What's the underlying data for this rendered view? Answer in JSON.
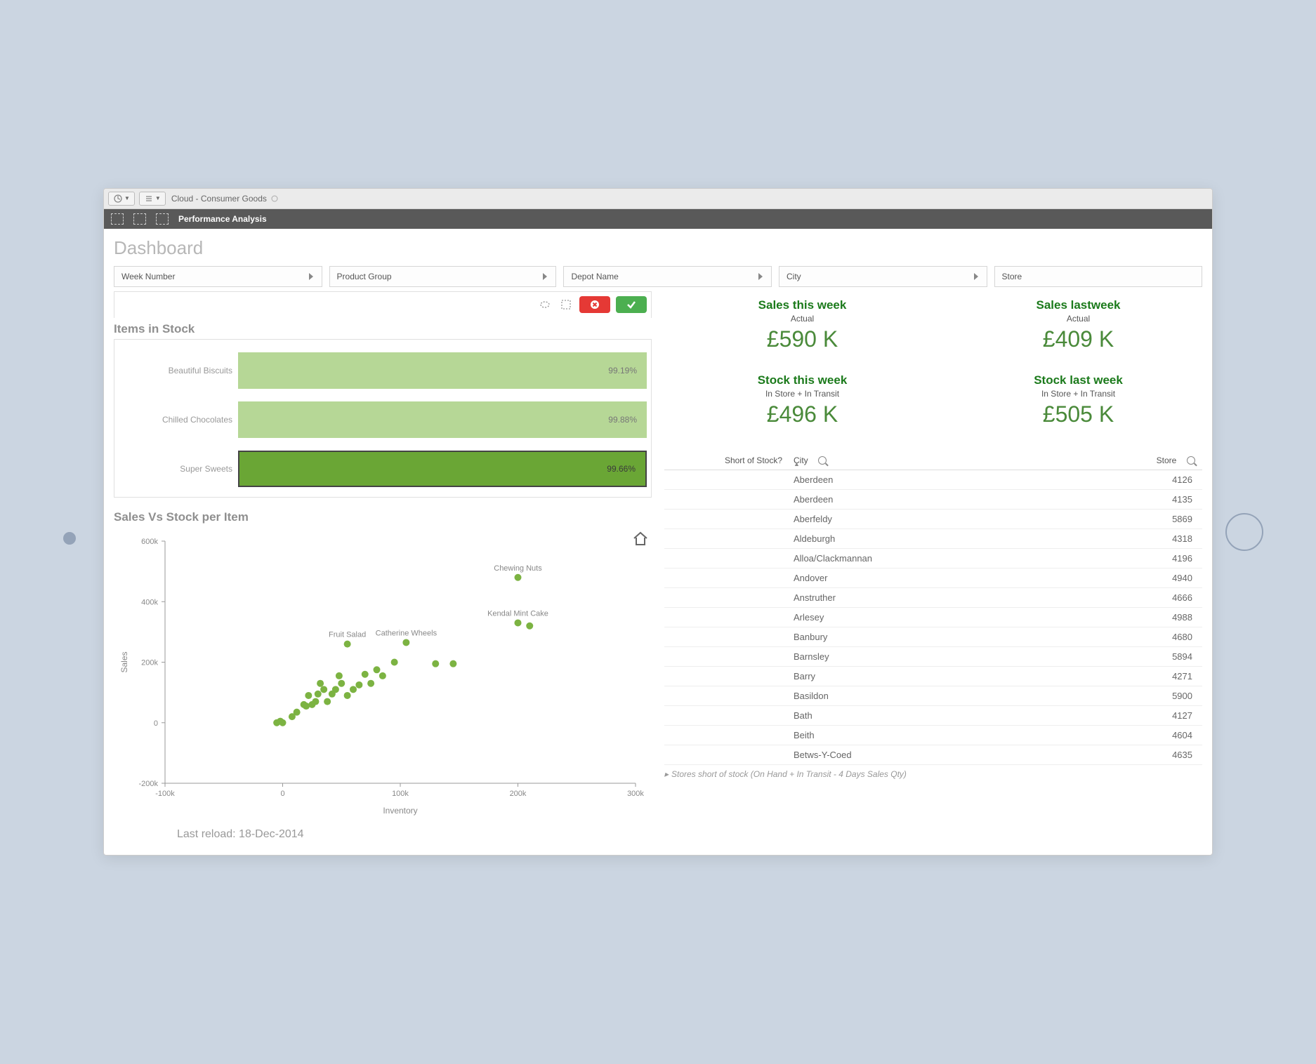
{
  "titlebar": {
    "app_name": "Cloud - Consumer Goods"
  },
  "darkbar": {
    "title": "Performance Analysis"
  },
  "dashboard_heading": "Dashboard",
  "filters": [
    {
      "label": "Week Number"
    },
    {
      "label": "Product Group"
    },
    {
      "label": "Depot Name"
    },
    {
      "label": "City"
    },
    {
      "label": "Store"
    }
  ],
  "items_in_stock": {
    "title": "Items in Stock",
    "rows": [
      {
        "label": "Beautiful Biscuits",
        "value_label": "99.19%",
        "selected": false
      },
      {
        "label": "Chilled Chocolates",
        "value_label": "99.88%",
        "selected": false
      },
      {
        "label": "Super Sweets",
        "value_label": "99.66%",
        "selected": true
      }
    ]
  },
  "kpis": {
    "sales_this_week": {
      "title": "Sales this week",
      "sub": "Actual",
      "value": "£590 K"
    },
    "sales_last_week": {
      "title": "Sales lastweek",
      "sub": "Actual",
      "value": "£409 K"
    },
    "stock_this_week": {
      "title": "Stock this week",
      "sub": "In Store + In Transit",
      "value": "£496 K"
    },
    "stock_last_week": {
      "title": "Stock last week",
      "sub": "In Store + In Transit",
      "value": "£505 K"
    }
  },
  "scatter": {
    "title": "Sales Vs Stock per Item",
    "xlabel": "Inventory",
    "ylabel": "Sales"
  },
  "reload_text": "Last reload: 18-Dec-2014",
  "table": {
    "headers": {
      "short": "Short of Stock?",
      "city": "City",
      "store": "Store"
    },
    "rows": [
      {
        "city": "Aberdeen",
        "store": "4126"
      },
      {
        "city": "Aberdeen",
        "store": "4135"
      },
      {
        "city": "Aberfeldy",
        "store": "5869"
      },
      {
        "city": "Aldeburgh",
        "store": "4318"
      },
      {
        "city": "Alloa/Clackmannan",
        "store": "4196"
      },
      {
        "city": "Andover",
        "store": "4940"
      },
      {
        "city": "Anstruther",
        "store": "4666"
      },
      {
        "city": "Arlesey",
        "store": "4988"
      },
      {
        "city": "Banbury",
        "store": "4680"
      },
      {
        "city": "Barnsley",
        "store": "5894"
      },
      {
        "city": "Barry",
        "store": "4271"
      },
      {
        "city": "Basildon",
        "store": "5900"
      },
      {
        "city": "Bath",
        "store": "4127"
      },
      {
        "city": "Beith",
        "store": "4604"
      },
      {
        "city": "Betws-Y-Coed",
        "store": "4635"
      }
    ],
    "footer": "Stores short of stock (On Hand + In Transit - 4 Days Sales Qty)"
  },
  "chart_data": [
    {
      "type": "bar",
      "title": "Items in Stock",
      "orientation": "horizontal",
      "categories": [
        "Beautiful Biscuits",
        "Chilled Chocolates",
        "Super Sweets"
      ],
      "values": [
        99.19,
        99.88,
        99.66
      ],
      "value_suffix": "%",
      "selected_index": 2,
      "xlim": [
        0,
        100
      ]
    },
    {
      "type": "scatter",
      "title": "Sales Vs Stock per Item",
      "xlabel": "Inventory",
      "ylabel": "Sales",
      "xlim": [
        -100000,
        300000
      ],
      "ylim": [
        -200000,
        600000
      ],
      "x_ticks": [
        -100000,
        0,
        100000,
        200000,
        300000
      ],
      "y_ticks": [
        -200000,
        0,
        200000,
        400000,
        600000
      ],
      "series": [
        {
          "name": "Items",
          "points": [
            {
              "x": 200000,
              "y": 480000,
              "label": "Chewing Nuts"
            },
            {
              "x": 200000,
              "y": 330000,
              "label": "Kendal Mint Cake"
            },
            {
              "x": 210000,
              "y": 320000
            },
            {
              "x": 105000,
              "y": 265000,
              "label": "Catherine Wheels"
            },
            {
              "x": 55000,
              "y": 260000,
              "label": "Fruit Salad"
            },
            {
              "x": 130000,
              "y": 195000
            },
            {
              "x": 145000,
              "y": 195000
            },
            {
              "x": 95000,
              "y": 200000
            },
            {
              "x": 80000,
              "y": 175000
            },
            {
              "x": 85000,
              "y": 155000
            },
            {
              "x": 70000,
              "y": 160000
            },
            {
              "x": 75000,
              "y": 130000
            },
            {
              "x": 65000,
              "y": 125000
            },
            {
              "x": 60000,
              "y": 110000
            },
            {
              "x": 55000,
              "y": 90000
            },
            {
              "x": 50000,
              "y": 130000
            },
            {
              "x": 48000,
              "y": 155000
            },
            {
              "x": 45000,
              "y": 110000
            },
            {
              "x": 42000,
              "y": 95000
            },
            {
              "x": 38000,
              "y": 70000
            },
            {
              "x": 35000,
              "y": 110000
            },
            {
              "x": 32000,
              "y": 130000
            },
            {
              "x": 30000,
              "y": 95000
            },
            {
              "x": 28000,
              "y": 70000
            },
            {
              "x": 25000,
              "y": 60000
            },
            {
              "x": 22000,
              "y": 90000
            },
            {
              "x": 20000,
              "y": 55000
            },
            {
              "x": 18000,
              "y": 60000
            },
            {
              "x": 12000,
              "y": 35000
            },
            {
              "x": 8000,
              "y": 20000
            },
            {
              "x": -2000,
              "y": 5000
            },
            {
              "x": -5000,
              "y": 0
            },
            {
              "x": 0,
              "y": 0
            }
          ]
        }
      ]
    }
  ]
}
